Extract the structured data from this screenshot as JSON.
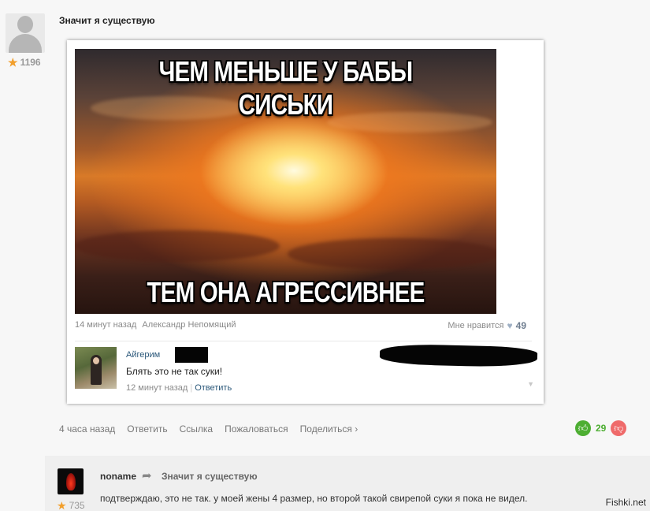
{
  "post": {
    "title": "Значит я существую",
    "author_rating": "1196",
    "meme": {
      "top_text": "ЧЕМ МЕНЬШЕ У БАБЫ СИСЬКИ",
      "bottom_text": "ТЕМ ОНА АГРЕССИВНЕЕ"
    },
    "vk": {
      "time": "14 минут назад",
      "author": "Александр Непомящий",
      "likes_label": "Мне нравится",
      "likes_count": "49",
      "reply": {
        "name": "Айгерим",
        "text": "Блять это не так суки!",
        "time": "12 минут назад",
        "separator": "|",
        "answer_label": "Ответить"
      }
    },
    "actions": {
      "time": "4 часа назад",
      "reply": "Ответить",
      "link": "Ссылка",
      "report": "Пожаловаться",
      "share": "Поделиться ›"
    },
    "votes": "29"
  },
  "comment": {
    "username": "noname",
    "reply_to": "Значит я существую",
    "rating": "735",
    "text": "подтверждаю, это не так. у моей жены 4 размер, но второй такой свирепой суки я пока не видел."
  },
  "watermark": "Fishki.net",
  "icons": {
    "star": "star-icon",
    "heart": "heart-icon",
    "thumb_up": "thumb-up-icon",
    "thumb_down": "thumb-down-icon",
    "reply_arrow": "reply-arrow-icon"
  },
  "colors": {
    "vote_up": "#4dae32",
    "vote_down": "#ef6a6a",
    "vk_link": "#2b587a",
    "star": "#f29f2c"
  }
}
